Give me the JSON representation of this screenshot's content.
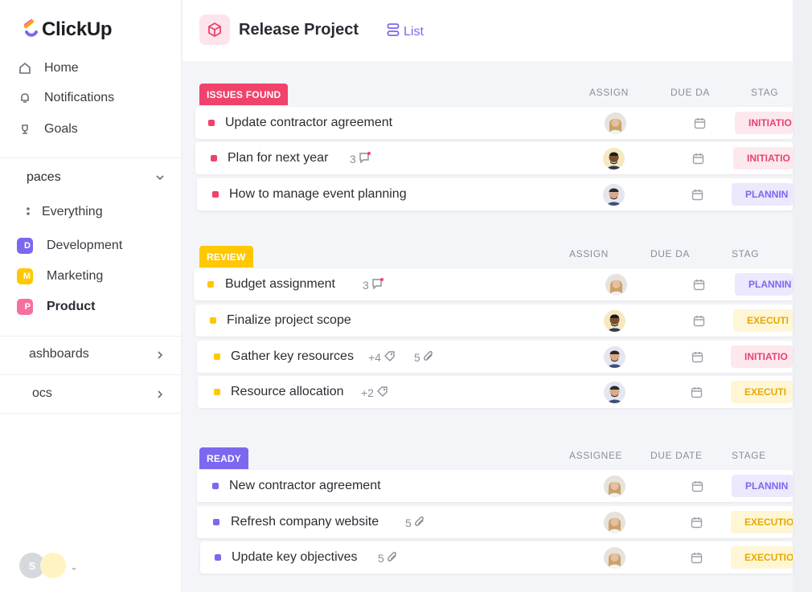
{
  "sidebar": {
    "brand": "ClickUp",
    "nav": [
      {
        "label": "Home",
        "icon": "home-icon"
      },
      {
        "label": "Notifications",
        "icon": "bell-icon"
      },
      {
        "label": "Goals",
        "icon": "trophy-icon"
      }
    ],
    "spaces_label": "paces",
    "everything_label": "Everything",
    "spaces": [
      {
        "label": "Development",
        "letter": "D",
        "color": "#7b68ee"
      },
      {
        "label": "Marketing",
        "letter": "M",
        "color": "#ffc800"
      },
      {
        "label": "Product",
        "letter": "P",
        "color": "#f56fa0"
      }
    ],
    "dashboards_label": "ashboards",
    "docs_label": "ocs",
    "user_initial": "S"
  },
  "header": {
    "project_title": "Release Project",
    "view_tab": "List"
  },
  "columns": {
    "truncated": {
      "assignee": "ASSIGN",
      "due": "DUE DA",
      "stage": "STAG"
    },
    "full": {
      "assignee": "ASSIGNEE",
      "due": "DUE DATE",
      "stage": "STAGE"
    }
  },
  "groups": [
    {
      "label": "ISSUES FOUND",
      "color": "#f0426b",
      "tasks": [
        {
          "name": "Update contractor agreement",
          "stage": "INITIATIO"
        },
        {
          "name": "Plan for next year",
          "comments": "3",
          "stage": "INITIATIO"
        },
        {
          "name": "How to manage event planning",
          "stage": "PLANNIN"
        }
      ]
    },
    {
      "label": "REVIEW",
      "color": "#ffc800",
      "tasks": [
        {
          "name": "Budget assignment",
          "comments": "3",
          "stage": "PLANNIN"
        },
        {
          "name": "Finalize project scope",
          "stage": "EXECUTI"
        },
        {
          "name": "Gather key resources",
          "tags": "+4",
          "attachments": "5",
          "stage": "INITIATIO"
        },
        {
          "name": "Resource allocation",
          "tags": "+2",
          "stage": "EXECUTI"
        }
      ]
    },
    {
      "label": "READY",
      "color": "#7b68ee",
      "tasks": [
        {
          "name": "New contractor agreement",
          "stage": "PLANNIN"
        },
        {
          "name": "Refresh company website",
          "attachments": "5",
          "stage": "EXECUTIO"
        },
        {
          "name": "Update key objectives",
          "attachments": "5",
          "stage": "EXECUTIO"
        }
      ]
    }
  ],
  "stage_colors": {
    "initiation": {
      "bg": "#fde8ee",
      "fg": "#e8436e"
    },
    "planning": {
      "bg": "#ece8fd",
      "fg": "#7b68ee"
    },
    "execution": {
      "bg": "#fff6d6",
      "fg": "#e8a800"
    }
  }
}
